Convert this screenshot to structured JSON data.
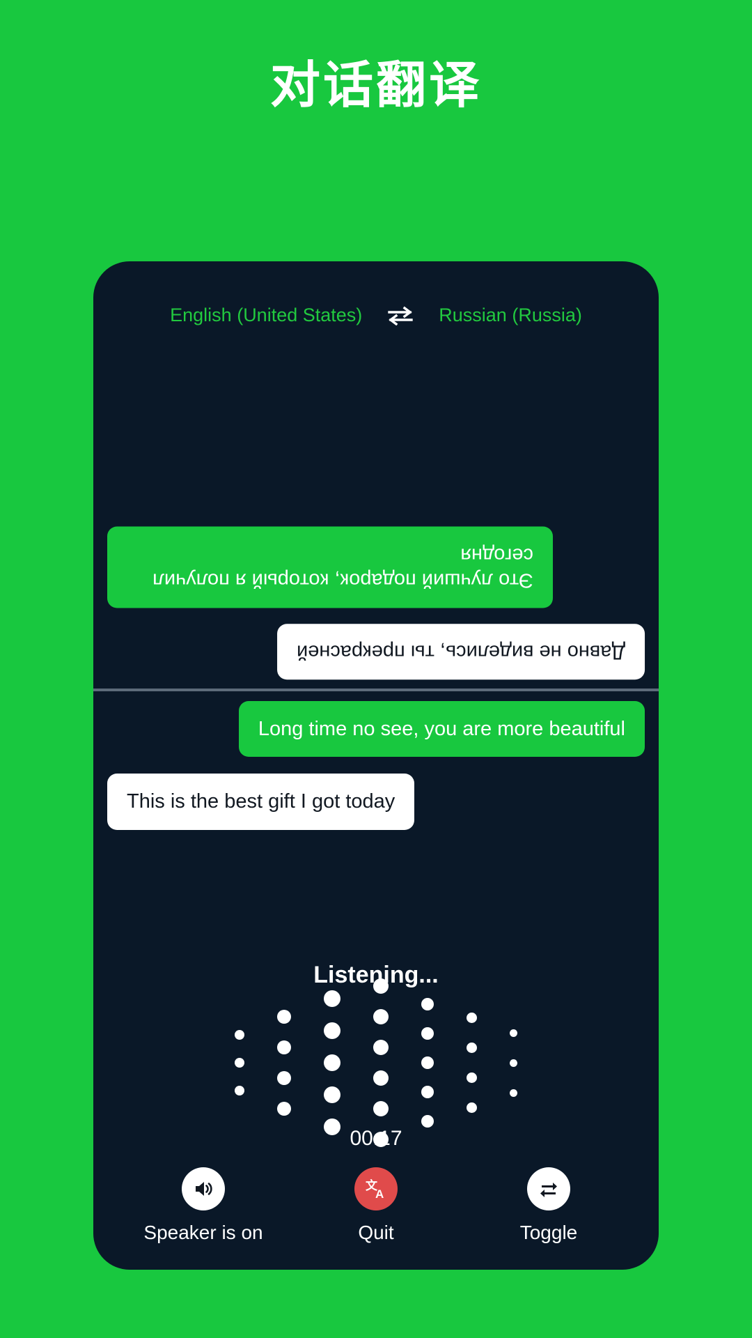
{
  "page": {
    "title": "对话翻译",
    "background_color": "#18c83f",
    "card_color": "#0a1828",
    "accent_green": "#18c83f",
    "accent_red": "#e04b4b",
    "lang_text_color": "#22c93f"
  },
  "language_bar": {
    "source_language": "English (United States)",
    "swap_icon": "swap-horizontal-icon",
    "target_language": "Russian (Russia)"
  },
  "conversation": {
    "top_pane": {
      "orientation": "rotated-180",
      "messages": [
        {
          "text": "Это лучший подарок, который я получил сегодня",
          "style": "green",
          "align": "left"
        },
        {
          "text": "Давно не виделись, ты прекрасней",
          "style": "white",
          "align": "right"
        }
      ]
    },
    "bottom_pane": {
      "orientation": "normal",
      "messages": [
        {
          "text": "Long time no see, you are more beautiful",
          "style": "green",
          "align": "right"
        },
        {
          "text": "This is the best gift I got today",
          "style": "white",
          "align": "left"
        }
      ]
    }
  },
  "listening": {
    "status_text": "Listening...",
    "timer": "00:17",
    "waveform": {
      "columns": [
        {
          "dots": 3,
          "size": 14,
          "gap": 26
        },
        {
          "dots": 4,
          "size": 20,
          "gap": 24
        },
        {
          "dots": 5,
          "size": 24,
          "gap": 22
        },
        {
          "dots": 6,
          "size": 22,
          "gap": 22
        },
        {
          "dots": 5,
          "size": 18,
          "gap": 24
        },
        {
          "dots": 4,
          "size": 15,
          "gap": 28
        },
        {
          "dots": 3,
          "size": 11,
          "gap": 32
        }
      ]
    }
  },
  "controls": [
    {
      "label": "Speaker is on",
      "icon": "speaker-on-icon",
      "style": "white"
    },
    {
      "label": "Quit",
      "icon": "translate-icon",
      "style": "red"
    },
    {
      "label": "Toggle",
      "icon": "toggle-swap-icon",
      "style": "white"
    }
  ]
}
